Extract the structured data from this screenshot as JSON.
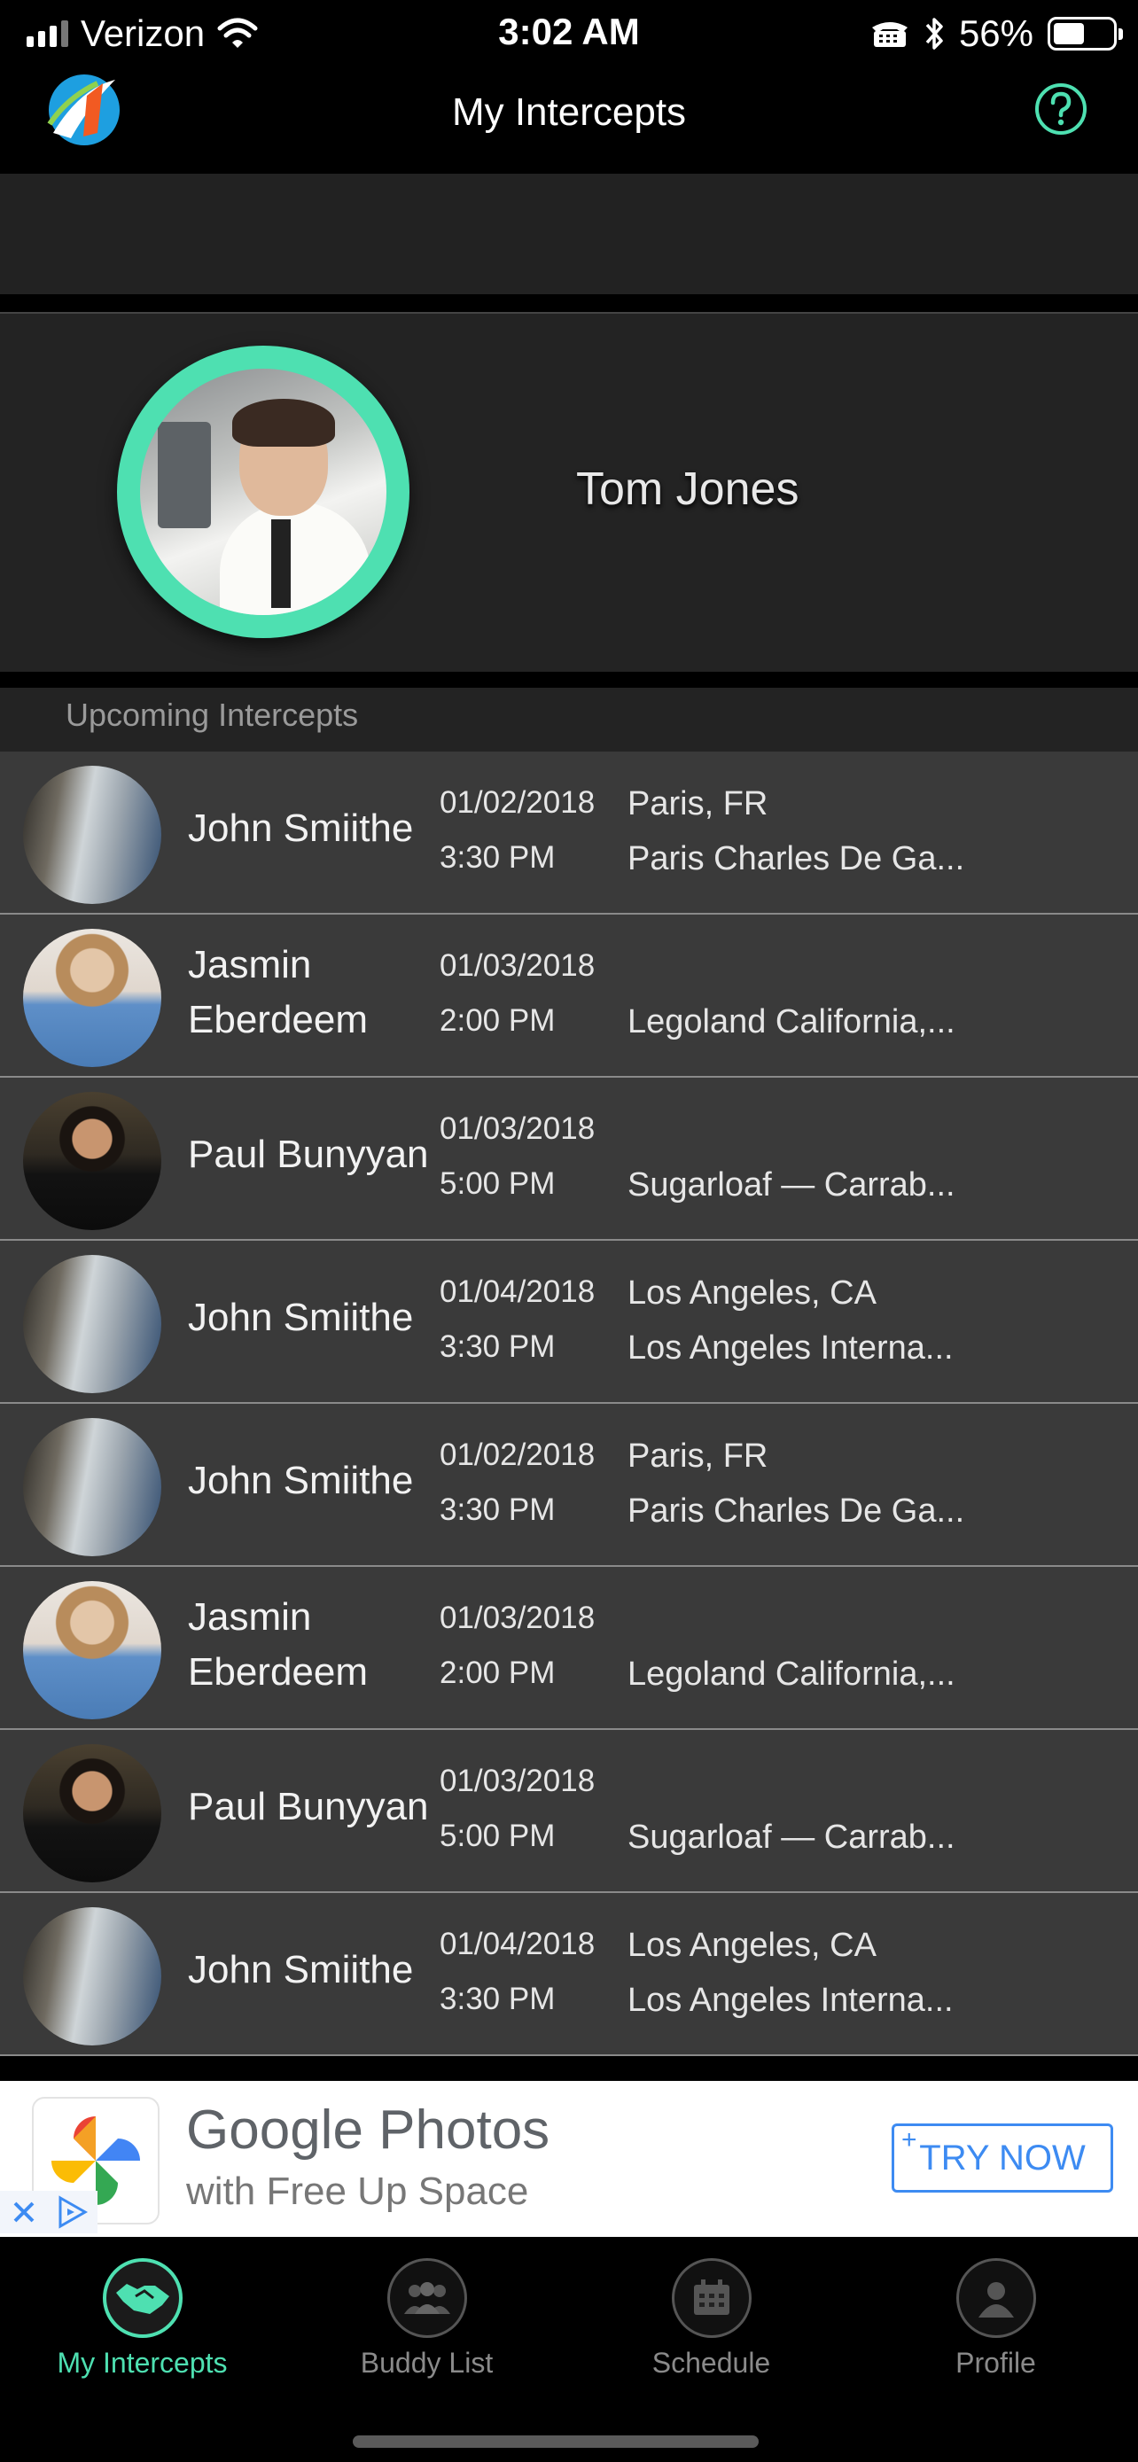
{
  "status_bar": {
    "carrier": "Verizon",
    "time": "3:02 AM",
    "battery": "56%",
    "battery_level": 0.56
  },
  "nav": {
    "title": "My Intercepts"
  },
  "profile": {
    "name": "Tom Jones"
  },
  "section": {
    "title": "Upcoming Intercepts"
  },
  "intercepts": [
    {
      "name": "John Smiithe",
      "date": "01/02/2018",
      "time": "3:30 PM",
      "location": "Paris, FR",
      "place": "Paris Charles De Ga..."
    },
    {
      "name": "Jasmin Eberdeem",
      "date": "01/03/2018",
      "time": "2:00 PM",
      "location": "",
      "place": "Legoland California,..."
    },
    {
      "name": "Paul Bunyyan",
      "date": "01/03/2018",
      "time": "5:00 PM",
      "location": "",
      "place": "Sugarloaf — Carrab..."
    },
    {
      "name": "John Smiithe",
      "date": "01/04/2018",
      "time": "3:30 PM",
      "location": "Los Angeles, CA",
      "place": "Los Angeles Interna..."
    },
    {
      "name": "John Smiithe",
      "date": "01/02/2018",
      "time": "3:30 PM",
      "location": "Paris, FR",
      "place": "Paris Charles De Ga..."
    },
    {
      "name": "Jasmin Eberdeem",
      "date": "01/03/2018",
      "time": "2:00 PM",
      "location": "",
      "place": "Legoland California,..."
    },
    {
      "name": "Paul Bunyyan",
      "date": "01/03/2018",
      "time": "5:00 PM",
      "location": "",
      "place": "Sugarloaf — Carrab..."
    },
    {
      "name": "John Smiithe",
      "date": "01/04/2018",
      "time": "3:30 PM",
      "location": "Los Angeles, CA",
      "place": "Los Angeles Interna..."
    }
  ],
  "ad": {
    "title": "Google Photos",
    "subtitle": "with Free Up Space",
    "cta": "TRY NOW"
  },
  "tabs": [
    {
      "label": "My Intercepts",
      "icon": "handshake-icon",
      "active": true
    },
    {
      "label": "Buddy List",
      "icon": "group-icon",
      "active": false
    },
    {
      "label": "Schedule",
      "icon": "calendar-icon",
      "active": false
    },
    {
      "label": "Profile",
      "icon": "person-icon",
      "active": false
    }
  ],
  "colors": {
    "accent": "#4ee0b1",
    "row_background": "#3a3a3a",
    "ad_button": "#3d8bf2"
  }
}
